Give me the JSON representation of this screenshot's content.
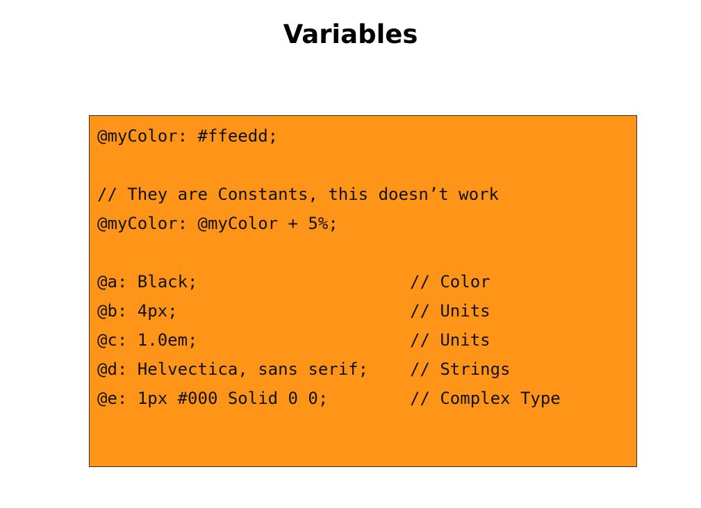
{
  "slide": {
    "title": "Variables",
    "code_box_color": "#FF9518"
  },
  "code": {
    "lines": [
      {
        "stmt": "@myColor: #ffeedd;",
        "comment": ""
      },
      {
        "stmt": "",
        "comment": ""
      },
      {
        "stmt": "// They are Constants, this doesn’t work",
        "comment": ""
      },
      {
        "stmt": "@myColor: @myColor + 5%;",
        "comment": ""
      },
      {
        "stmt": "",
        "comment": ""
      },
      {
        "stmt": "@a: Black;",
        "comment": "// Color"
      },
      {
        "stmt": "@b: 4px;",
        "comment": "// Units"
      },
      {
        "stmt": "@c: 1.0em;",
        "comment": "// Units"
      },
      {
        "stmt": "@d: Helvectica, sans serif;",
        "comment": "// Strings"
      },
      {
        "stmt": "@e: 1px #000 Solid 0 0;",
        "comment": "// Complex Type"
      }
    ]
  }
}
